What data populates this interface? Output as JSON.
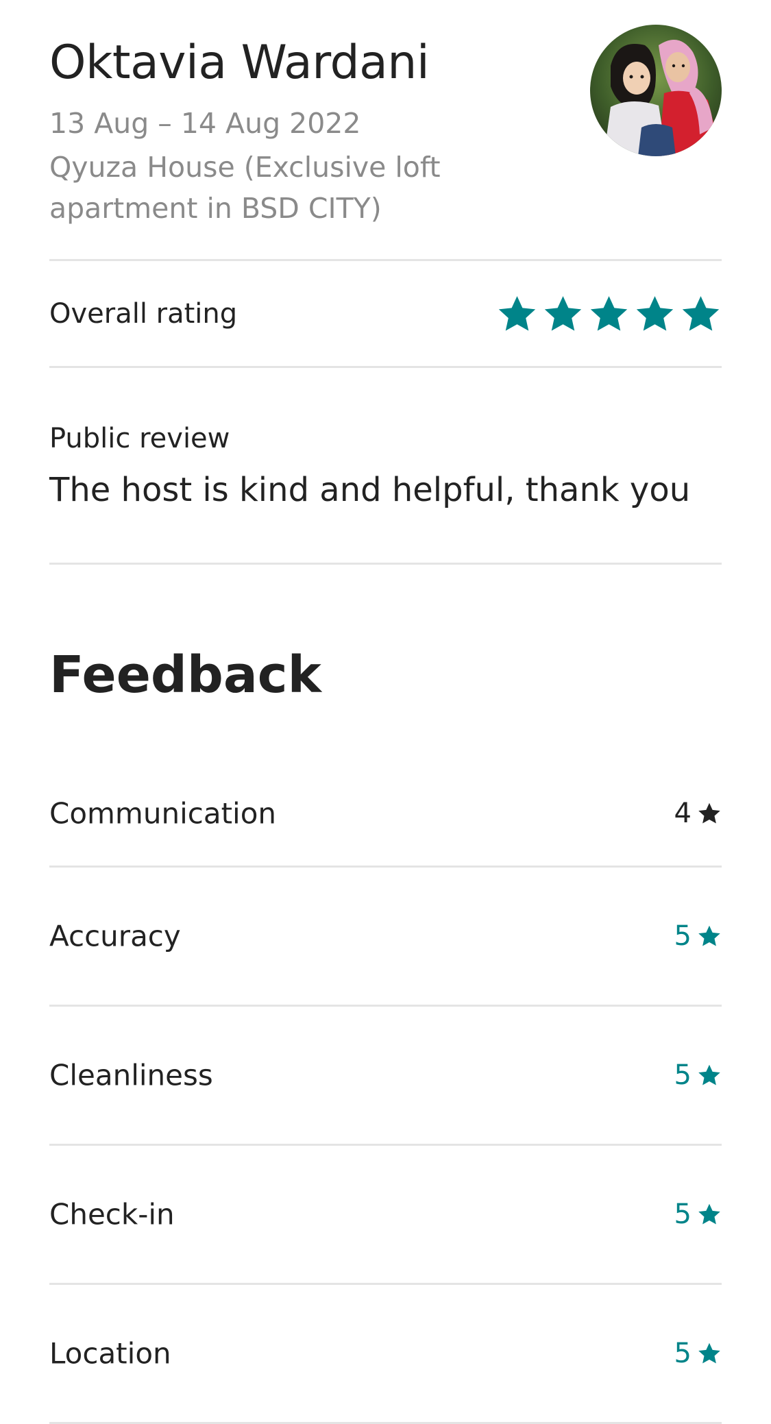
{
  "guest": {
    "name": "Oktavia Wardani",
    "dates": "13 Aug – 14 Aug 2022",
    "listing": "Qyuza House (Exclusive loft apartment in BSD CITY)"
  },
  "overall": {
    "label": "Overall rating",
    "stars": 5,
    "star_color": "#008489"
  },
  "review": {
    "label": "Public review",
    "text": "The host is kind and helpful, thank you"
  },
  "feedback": {
    "title": "Feedback",
    "items": [
      {
        "label": "Communication",
        "score": "4",
        "color": "#222222"
      },
      {
        "label": "Accuracy",
        "score": "5",
        "color": "#008489"
      },
      {
        "label": "Cleanliness",
        "score": "5",
        "color": "#008489"
      },
      {
        "label": "Check-in",
        "score": "5",
        "color": "#008489"
      },
      {
        "label": "Location",
        "score": "5",
        "color": "#008489"
      }
    ]
  },
  "icons": {
    "avatar": "guest-avatar-photo",
    "star": "star-icon"
  }
}
